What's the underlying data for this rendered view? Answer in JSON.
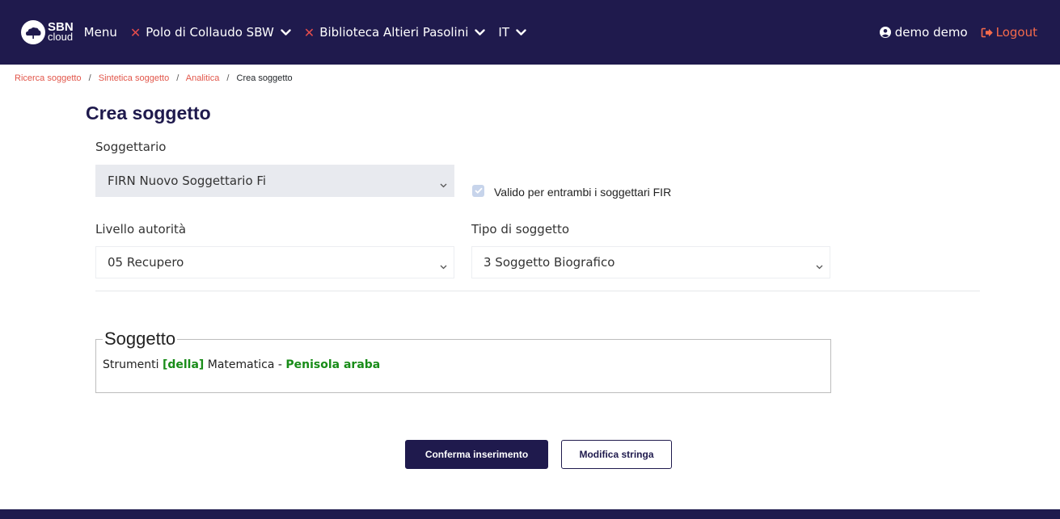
{
  "navbar": {
    "logo": {
      "line1": "SBN",
      "line2": "cloud"
    },
    "menu_label": "Menu",
    "polo_label": "Polo di Collaudo SBW",
    "biblioteca_label": "Biblioteca Altieri Pasolini",
    "lang_label": "IT",
    "user_label": "demo demo",
    "logout_label": "Logout",
    "colors": {
      "background": "#1f1a4d",
      "close_x": "#e24c4c",
      "logout": "#f46a4b"
    }
  },
  "breadcrumb": {
    "items": [
      "Ricerca soggetto",
      "Sintetica soggetto",
      "Analitica"
    ],
    "current": "Crea soggetto",
    "separator": "/"
  },
  "page": {
    "title": "Crea soggetto"
  },
  "form": {
    "soggettario": {
      "label": "Soggettario",
      "value": "FIRN Nuovo Soggettario Fi"
    },
    "checkbox": {
      "label": "Valido per entrambi i soggettari FIR",
      "checked": true,
      "disabled": true
    },
    "livello": {
      "label": "Livello autorità",
      "value": "05 Recupero"
    },
    "tipo": {
      "label": "Tipo di soggetto",
      "value": "3 Soggetto Biografico"
    }
  },
  "soggetto": {
    "legend": "Soggetto",
    "part1": "Strumenti ",
    "part2": "[della]",
    "part3": " Matematica - ",
    "part4": "Penisola araba",
    "highlight_color": "#188c18"
  },
  "buttons": {
    "confirm": "Conferma inserimento",
    "modify": "Modifica stringa"
  }
}
